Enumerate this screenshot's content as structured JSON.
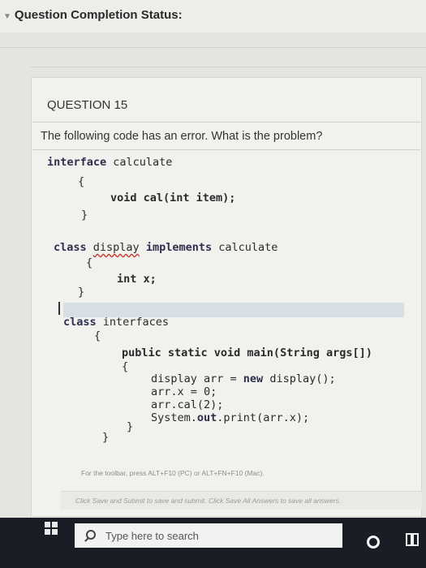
{
  "status": {
    "title": "Question Completion Status:"
  },
  "question": {
    "header": "QUESTION 15",
    "prompt": "The following code has an error. What is the problem?"
  },
  "code": {
    "l1_kw": "interface",
    "l1_rest": " calculate",
    "l2": "{",
    "l3": "void cal(int item);",
    "l4": "}",
    "l5_kw1": "class",
    "l5_name": "display",
    "l5_kw2": "implements",
    "l5_rest": "calculate",
    "l6": "{",
    "l7": "int x;",
    "l8": "}",
    "l9_kw": "class",
    "l9_rest": " interfaces",
    "l10": "{",
    "l11": "public static void main(String args[])",
    "l12": "{",
    "l13a": "display arr = ",
    "l13b": "new",
    "l13c": " display();",
    "l14": "arr.x = 0;",
    "l15": "arr.cal(2);",
    "l16a": "System.",
    "l16b": "out",
    "l16c": ".print(arr.x);",
    "l17": "}",
    "l18": "}"
  },
  "hints": {
    "toolbar": "For the toolbar, press ALT+F10 (PC) or ALT+FN+F10 (Mac).",
    "save": "Click Save and Submit to save and submit. Click Save All Answers to save all answers."
  },
  "taskbar": {
    "search_placeholder": "Type here to search"
  },
  "colors": {
    "taskbar": "#1b1d26",
    "page": "#e4e4e0"
  }
}
